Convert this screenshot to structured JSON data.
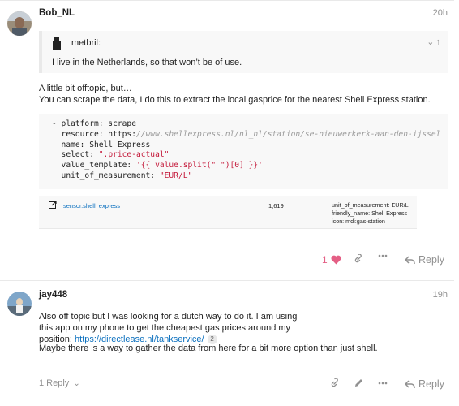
{
  "post1": {
    "username": "Bob_NL",
    "timestamp": "20h",
    "quote": {
      "user": "metbril:",
      "text": "I live in the Netherlands, so that won’t be of use."
    },
    "intro_line1": "A little bit offtopic, but…",
    "intro_line2": "You can scrape the data, I do this to extract the local gasprice for the nearest Shell Express station.",
    "code": {
      "l1": "- platform: scrape",
      "l2_key": "  resource: https:",
      "l2_url": "//www.shellexpress.nl/nl_nl/station/se-nieuwerkerk-aan-den-ijssel",
      "l3": "  name: Shell Express",
      "l4_key": "  select: ",
      "l4_val": "\".price-actual\"",
      "l5_key": "  value_template: ",
      "l5_val": "'{{ value.split(\" \")[0] }}'",
      "l6_key": "  unit_of_measurement: ",
      "l6_val": "\"EUR/L\""
    },
    "entity": {
      "name": "sensor.shell_express",
      "state": "1,619",
      "attr1": "unit_of_measurement: EUR/L",
      "attr2": "friendly_name: Shell Express",
      "attr3": "icon: mdi:gas-station"
    },
    "like_count": "1",
    "reply_label": "Reply"
  },
  "post2": {
    "username": "jay448",
    "timestamp": "19h",
    "para1_a": "Also off topic but I was looking for a dutch way to do it. I am using this app on my phone to get the cheapest gas prices around my position: ",
    "para1_link": "https://directlease.nl/tankservice/",
    "para1_badge": "2",
    "para2": "Maybe there is a way to gather the data from here for a bit more option than just shell.",
    "replies_label": "1 Reply",
    "reply_label": "Reply"
  },
  "colors": {
    "link": "#0a6fbe",
    "heart": "#e45f85",
    "muted": "#919191",
    "string": "#c4193a"
  }
}
